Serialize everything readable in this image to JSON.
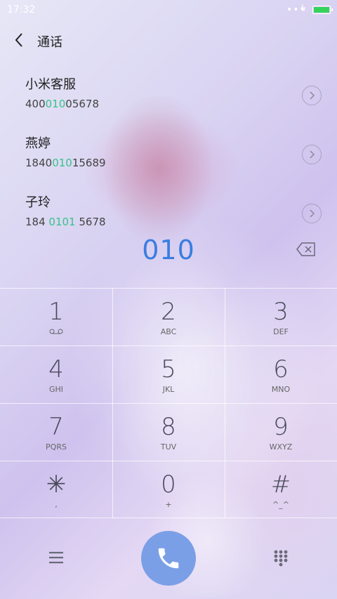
{
  "status_bar": {
    "time": "17:32",
    "dots": "•••",
    "charging": "ϟ"
  },
  "header": {
    "title": "通话"
  },
  "contacts": [
    {
      "name": "小米客服",
      "num_pre": "400",
      "num_hl": "010",
      "num_post": "05678"
    },
    {
      "name": "燕婷",
      "num_pre": "1840",
      "num_hl": "010",
      "num_post": "15689"
    },
    {
      "name": "子玲",
      "num_pre": "184 ",
      "num_hl": "0101",
      "num_post": " 5678"
    }
  ],
  "dialed_number": "010",
  "keypad": [
    {
      "digit": "1",
      "letters": ""
    },
    {
      "digit": "2",
      "letters": "ABC"
    },
    {
      "digit": "3",
      "letters": "DEF"
    },
    {
      "digit": "4",
      "letters": "GHI"
    },
    {
      "digit": "5",
      "letters": "JKL"
    },
    {
      "digit": "6",
      "letters": "MNO"
    },
    {
      "digit": "7",
      "letters": "PQRS"
    },
    {
      "digit": "8",
      "letters": "TUV"
    },
    {
      "digit": "9",
      "letters": "WXYZ"
    },
    {
      "digit": "✳",
      "letters": ","
    },
    {
      "digit": "0",
      "letters": "+"
    },
    {
      "digit": "#",
      "letters": "^_^"
    }
  ],
  "colors": {
    "accent": "#3b7de0",
    "highlight": "#38c28a",
    "call_button": "#7b9fe6",
    "battery": "#35d35a"
  },
  "icons": {
    "back": "back-chevron-icon",
    "detail": "chevron-right-circle-icon",
    "backspace": "backspace-icon",
    "voicemail": "voicemail-icon",
    "menu": "menu-icon",
    "call": "phone-icon",
    "keypad": "keypad-icon"
  }
}
